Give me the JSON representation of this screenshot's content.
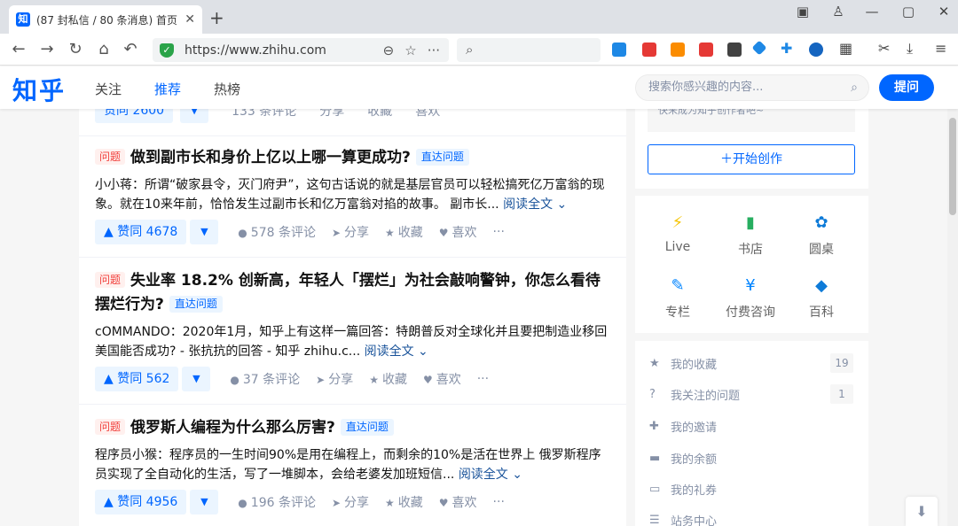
{
  "browser": {
    "tab_title": "(87 封私信 / 80 条消息) 首页",
    "favicon": "知",
    "close": "✕",
    "new_tab": "+",
    "url": "https://www.zhihu.com"
  },
  "header": {
    "logo": "知乎",
    "nav": [
      "关注",
      "推荐",
      "热榜"
    ],
    "search_placeholder": "搜索你感兴趣的内容...",
    "ask_label": "提问"
  },
  "feed": {
    "partial_top": {
      "vote": "赞同 2600",
      "comments": "133 条评论",
      "share": "分享",
      "collect": "收藏",
      "like": "喜欢"
    },
    "items": [
      {
        "badge": "问题",
        "title": "做到副市长和身价上亿以上哪一算更成功?",
        "tag": "直达问题",
        "excerpt": "小小蒋：所谓“破家县令，灭门府尹”，这句古话说的就是基层官员可以轻松搞死亿万富翁的现象。就在10来年前，恰恰发生过副市长和亿万富翁对掐的故事。 副市长...",
        "read_more": "阅读全文 ⌄",
        "vote": "▲ 赞同 4678",
        "comments": "578 条评论",
        "share": "分享",
        "collect": "收藏",
        "like": "喜欢",
        "more": "···"
      },
      {
        "badge": "问题",
        "title": "失业率 18.2% 创新高，年轻人「摆烂」为社会敲响警钟，你怎么看待摆烂行为?",
        "tag": "直达问题",
        "excerpt": "cOMMANDO：2020年1月，知乎上有这样一篇回答：特朗普反对全球化并且要把制造业移回美国能否成功? - 张抗抗的回答 - 知乎 zhihu.c...",
        "read_more": "阅读全文 ⌄",
        "vote": "▲ 赞同 562",
        "comments": "37 条评论",
        "share": "分享",
        "collect": "收藏",
        "like": "喜欢",
        "more": "···"
      },
      {
        "badge": "问题",
        "title": "俄罗斯人编程为什么那么厉害?",
        "tag": "直达问题",
        "excerpt": "程序员小猴：程序员的一生时间90%是用在编程上，而剩余的10%是活在世界上 俄罗斯程序员实现了全自动化的生活，写了一堆脚本，会给老婆发加班短信...",
        "read_more": "阅读全文 ⌄",
        "vote": "▲ 赞同 4956",
        "comments": "196 条评论",
        "share": "分享",
        "collect": "收藏",
        "like": "喜欢",
        "more": "···"
      }
    ]
  },
  "sidebar": {
    "creator_hint": "快来成为知乎创作者吧~",
    "create_label": "＋开始创作",
    "grid": [
      {
        "icon": "⚡",
        "label": "Live",
        "color": "#f5c400"
      },
      {
        "icon": "▮",
        "label": "书店",
        "color": "#27ae60"
      },
      {
        "icon": "✿",
        "label": "圆桌",
        "color": "#0e7bd8"
      },
      {
        "icon": "✎",
        "label": "专栏",
        "color": "#0084ff"
      },
      {
        "icon": "¥",
        "label": "付费咨询",
        "color": "#0084ff"
      },
      {
        "icon": "◆",
        "label": "百科",
        "color": "#0e7bd8"
      }
    ],
    "links": [
      {
        "icon": "★",
        "label": "我的收藏",
        "count": "19"
      },
      {
        "icon": "?",
        "label": "我关注的问题",
        "count": "1"
      },
      {
        "icon": "✚",
        "label": "我的邀请",
        "count": ""
      },
      {
        "icon": "▬",
        "label": "我的余额",
        "count": ""
      },
      {
        "icon": "▭",
        "label": "我的礼券",
        "count": ""
      },
      {
        "icon": "☰",
        "label": "站务中心",
        "count": ""
      }
    ]
  }
}
